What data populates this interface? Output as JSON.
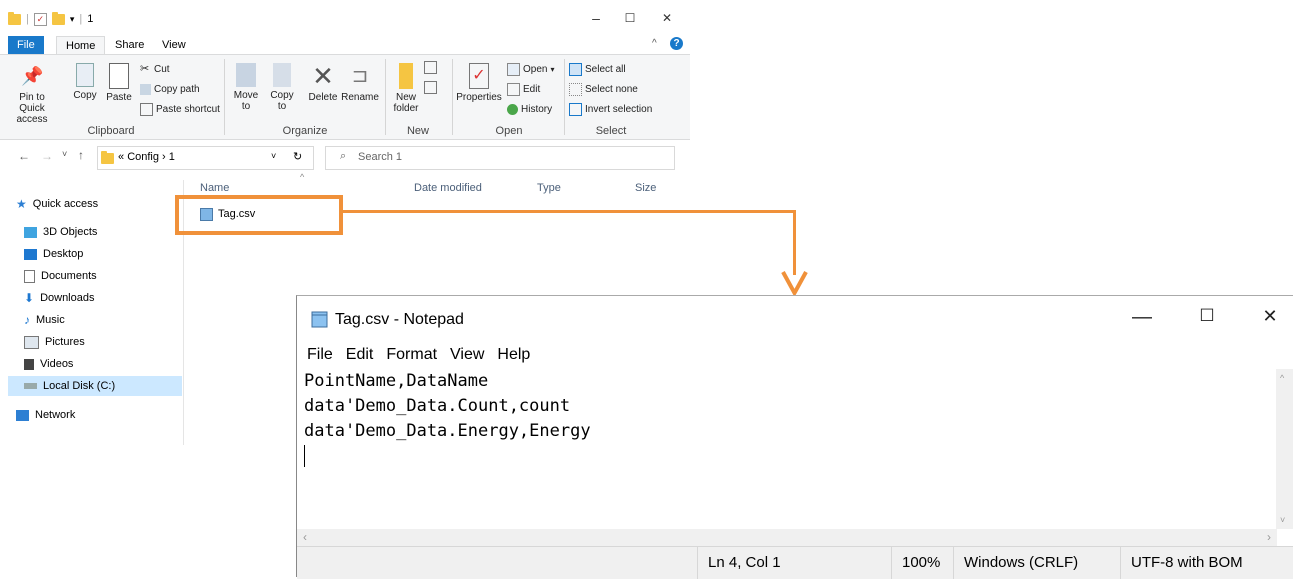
{
  "explorer": {
    "title": "1",
    "window_controls": {
      "minimize": "–",
      "maximize": "☐",
      "close": "✕"
    },
    "tabs": [
      {
        "label": "File"
      },
      {
        "label": "Home"
      },
      {
        "label": "Share"
      },
      {
        "label": "View"
      }
    ],
    "ribbon": {
      "clipboard": {
        "label": "Clipboard",
        "pin": "Pin to Quick access",
        "copy": "Copy",
        "paste": "Paste",
        "cut": "Cut",
        "copy_path": "Copy path",
        "paste_shortcut": "Paste shortcut"
      },
      "organize": {
        "label": "Organize",
        "move_to": "Move to",
        "copy_to": "Copy to",
        "delete": "Delete",
        "rename": "Rename"
      },
      "new": {
        "label": "New",
        "new_folder": "New folder"
      },
      "open": {
        "label": "Open",
        "properties": "Properties",
        "open": "Open",
        "edit": "Edit",
        "history": "History"
      },
      "select": {
        "label": "Select",
        "select_all": "Select all",
        "select_none": "Select none",
        "invert_selection": "Invert selection"
      }
    },
    "address": {
      "crumbs": [
        "«",
        "Config",
        "›",
        "1"
      ]
    },
    "search": {
      "placeholder": "Search 1"
    },
    "nav": [
      {
        "label": "Quick access",
        "icon": "star-icon"
      },
      {
        "label": "3D Objects",
        "icon": "cube-icon"
      },
      {
        "label": "Desktop",
        "icon": "desktop-icon"
      },
      {
        "label": "Documents",
        "icon": "documents-icon"
      },
      {
        "label": "Downloads",
        "icon": "download-icon"
      },
      {
        "label": "Music",
        "icon": "music-icon"
      },
      {
        "label": "Pictures",
        "icon": "pictures-icon"
      },
      {
        "label": "Videos",
        "icon": "videos-icon"
      },
      {
        "label": "Local Disk (C:)",
        "icon": "disk-icon"
      },
      {
        "label": "Network",
        "icon": "network-icon"
      }
    ],
    "columns": {
      "name": "Name",
      "date": "Date modified",
      "type": "Type",
      "size": "Size"
    },
    "files": [
      {
        "name": "Tag.csv"
      }
    ]
  },
  "notepad": {
    "title": "Tag.csv - Notepad",
    "window_controls": {
      "minimize": "—",
      "maximize": "☐",
      "close": "✕"
    },
    "menu": [
      "File",
      "Edit",
      "Format",
      "View",
      "Help"
    ],
    "lines": [
      "PointName,DataName",
      "data'Demo_Data.Count,count",
      "data'Demo_Data.Energy,Energy"
    ],
    "status": {
      "position": "Ln 4, Col 1",
      "zoom": "100%",
      "line_ending": "Windows (CRLF)",
      "encoding": "UTF-8 with BOM"
    }
  },
  "colors": {
    "annotation": "#f0913a",
    "file_tab": "#1979ca",
    "nav_selected": "#cce8ff"
  }
}
